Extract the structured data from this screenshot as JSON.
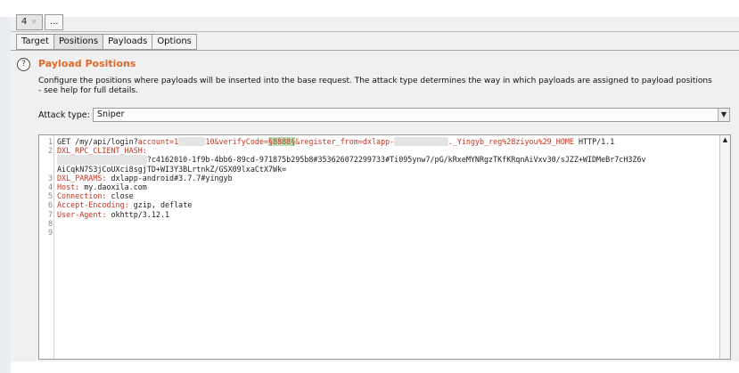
{
  "tabs": {
    "number_tab": "4",
    "number_tab_close": "×",
    "more_tab": "..."
  },
  "subtabs": [
    "Target",
    "Positions",
    "Payloads",
    "Options"
  ],
  "section": {
    "help_glyph": "?",
    "title": "Payload Positions",
    "description_line1": "Configure the positions where payloads will be inserted into the base request. The attack type determines the way in which payloads are assigned to payload positions",
    "description_line2": "- see help for full details."
  },
  "attack": {
    "label": "Attack type:",
    "value": "Sniper",
    "arrow_glyph": "▼"
  },
  "editor": {
    "scroll_up_glyph": "▲",
    "lines": [
      {
        "num": "1",
        "p1": "GET /my/api/login?",
        "p2": "account=1",
        "p3": "██████",
        "p4": "10&verifyCode=",
        "p5": "§8888§",
        "p6": "&register_from=dxlapp-",
        "p7": "████████████",
        "p8": "._Yingyb_reg%28ziyou%29_HOME",
        "p9": " HTTP/1.1"
      },
      {
        "num": "2",
        "p1": "DXL_RPC_CLIENT_HASH:"
      },
      {
        "num": "",
        "p1": "",
        "p2": "████████████████████",
        "p3": "?c4162010-1f9b-4bb6-89cd-971875b295b8#353626072299733#Ti095ynw7/pG/kRxeMYNRgzTKfKRqnAiVxv30/sJZZ+WIDMeBr7cH3Z6v"
      },
      {
        "num": "",
        "p1": "AiCqkN7S3jCoUXci8sgjTD+WI3Y3BLrtnkZ/GSX09lxaCtX7Wk="
      },
      {
        "num": "3",
        "p1": "DXL_PARAMS:",
        "p2": " dxlapp-android#3.7.7#yingyb"
      },
      {
        "num": "4",
        "p1": "Host:",
        "p2": " my.daoxila.com"
      },
      {
        "num": "5",
        "p1": "Connection:",
        "p2": " close"
      },
      {
        "num": "6",
        "p1": "Accept-Encoding:",
        "p2": " gzip, deflate"
      },
      {
        "num": "7",
        "p1": "User-Agent:",
        "p2": " okhttp/3.12.1"
      },
      {
        "num": "8",
        "p1": ""
      },
      {
        "num": "9",
        "p1": ""
      }
    ]
  }
}
